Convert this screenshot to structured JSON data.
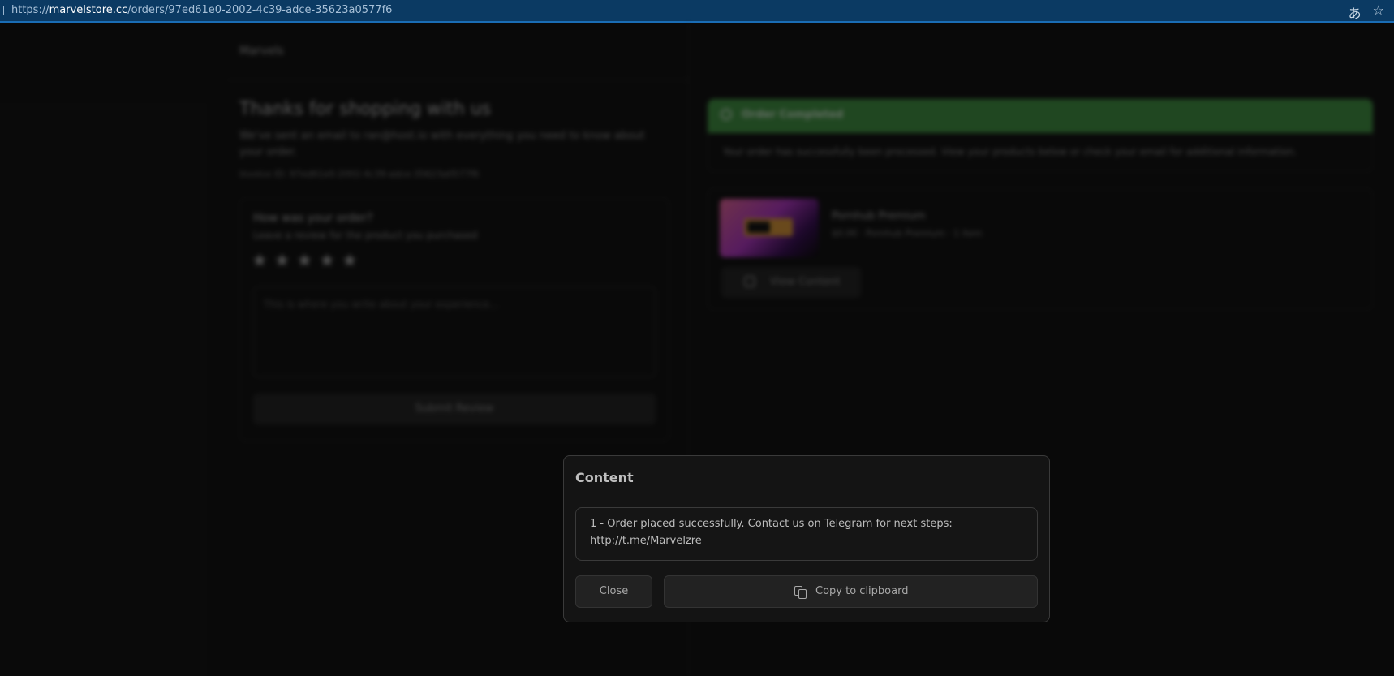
{
  "browser": {
    "url_prefix": "https://",
    "url_host": "marvelstore.cc",
    "url_path": "/orders/97ed61e0-2002-4c39-adce-35623a0577f6",
    "icons": [
      "translate-icon",
      "star-bookmark-icon"
    ]
  },
  "page": {
    "brand": "Marvels",
    "heading": "Thanks for shopping with us",
    "intro": "We've sent an email to ran@host.io with everything you need to know about your order.",
    "invoice": "Invoice ID: 97ed61e0-2002-4c39-adce-35623a0577f6",
    "review": {
      "title": "How was your order?",
      "subtitle": "Leave a review for the product you purchased",
      "stars": [
        "★",
        "★",
        "★",
        "★",
        "★"
      ],
      "placeholder": "This is where you write about your experience...",
      "submit_label": "Submit Review"
    },
    "status": {
      "label": "Order Completed",
      "message": "Your order has successfully been processed. View your products below or check your email for additional information.",
      "color": "#45a047"
    },
    "product": {
      "name": "Pornhub Premium",
      "meta": "$0.00 · Pornhub Premium · 1 item",
      "view_label": "View Content"
    }
  },
  "modal": {
    "title": "Content",
    "content_line1": "1 - Order placed successfully. Contact us on Telegram for next steps:",
    "content_line2": "http://t.me/Marvelzre",
    "close_label": "Close",
    "copy_label": "Copy to clipboard"
  }
}
